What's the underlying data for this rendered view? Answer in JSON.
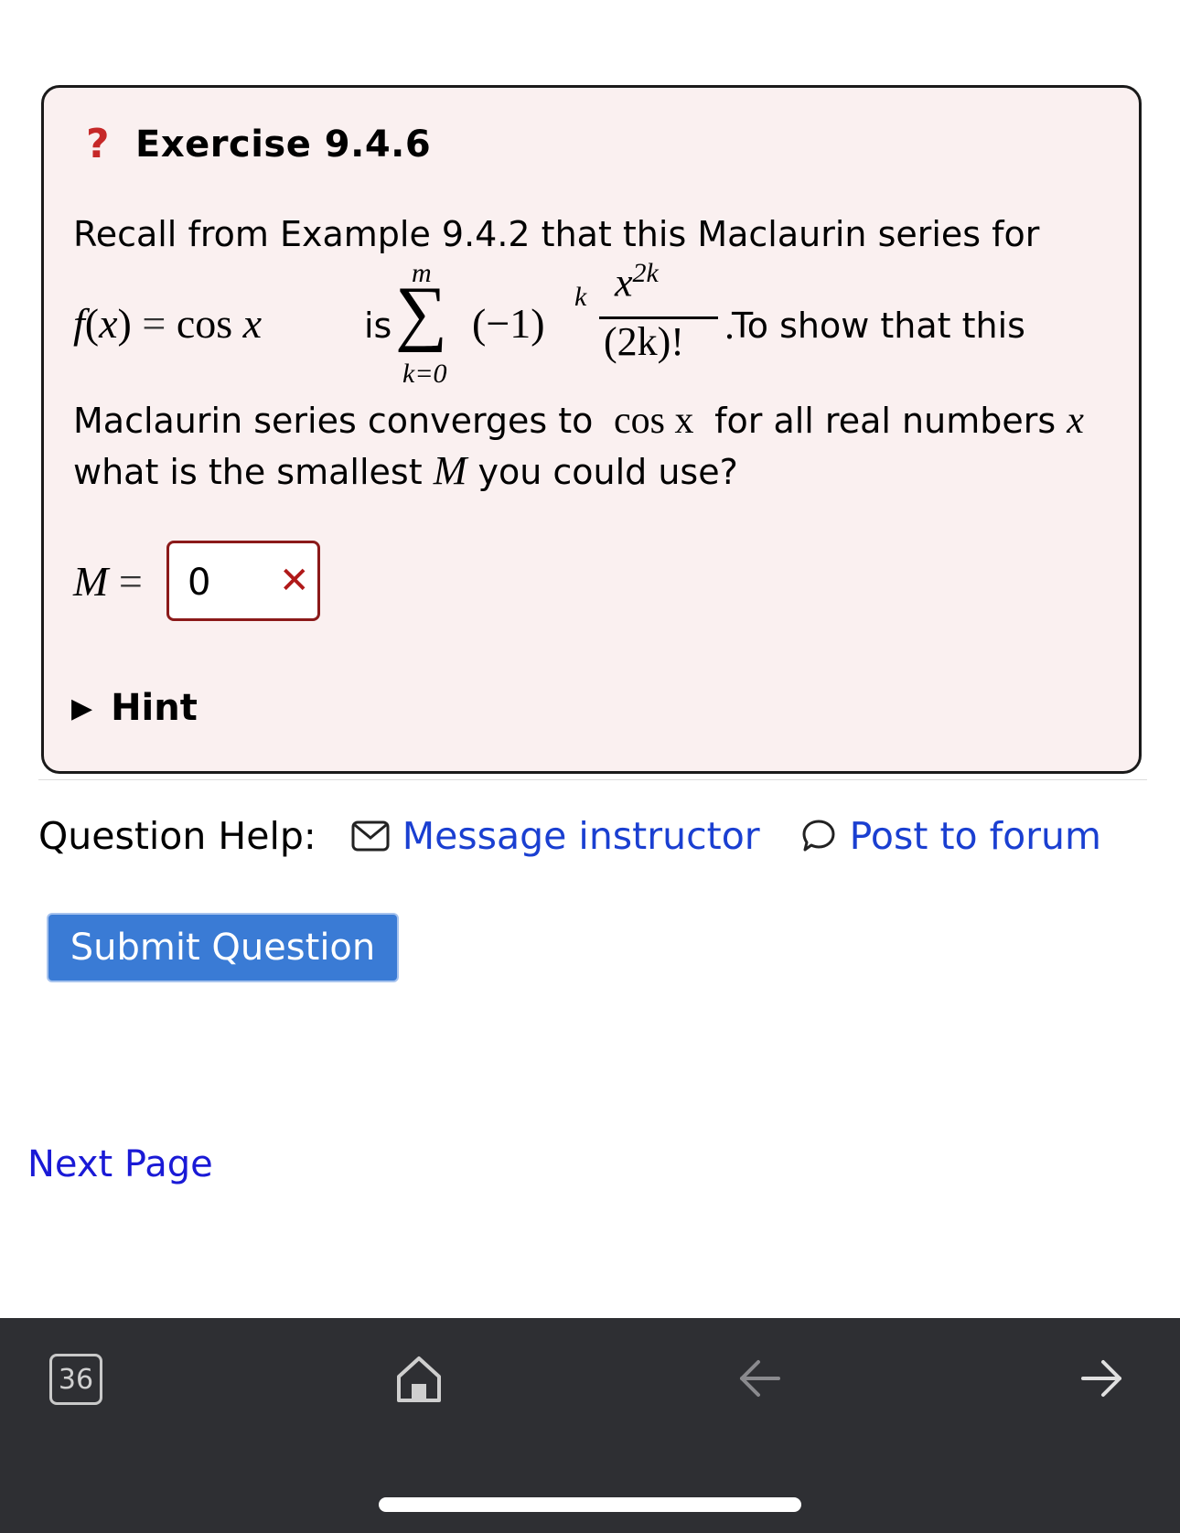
{
  "exercise": {
    "icon": "question-mark-icon",
    "icon_glyph": "?",
    "icon_color": "#c62828",
    "title": "Exercise 9.4.6",
    "text_line1": "Recall from Example 9.4.2 that this Maclaurin series for",
    "formula": {
      "lhs": "f(x) = cos x",
      "is_word": "is",
      "sum_upper": "m",
      "sum_lower": "k=0",
      "term": "(−1)",
      "term_exp": "k",
      "numerator": "x",
      "numerator_exp": "2k",
      "denominator": "(2k)!",
      "tail": "To show that this"
    },
    "text_line3_a": "Maclaurin series converges to",
    "text_line3_math": "cos x",
    "text_line3_b": "for all real numbers",
    "text_line3_var": "x",
    "text_line4_a": "what is the smallest",
    "text_line4_var": "M",
    "text_line4_b": "you could use?",
    "answer_label": "M",
    "answer_eq": "=",
    "answer_value": "0",
    "answer_status_icon": "incorrect-x-icon",
    "answer_status_glyph": "✕",
    "hint_label": "Hint"
  },
  "question_help": {
    "label": "Question Help:",
    "message_link": "Message instructor",
    "forum_link": "Post to forum",
    "link_color": "#1a3fd1"
  },
  "submit_label": "Submit Question",
  "submit_color": "#3a7bd5",
  "next_page_label": "Next Page",
  "browser_bar": {
    "tab_count": "36",
    "home_icon": "home-icon",
    "back_icon": "back-arrow-icon",
    "forward_icon": "forward-arrow-icon"
  }
}
